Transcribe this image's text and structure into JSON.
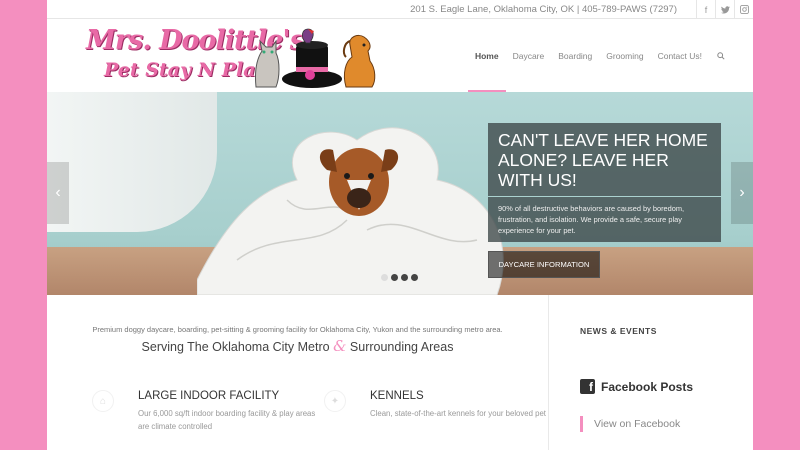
{
  "topbar": {
    "address": "201 S. Eagle Lane, Oklahoma City, OK | 405-789-PAWS (7297)",
    "social": [
      {
        "icon": "facebook-icon",
        "glyph": "f"
      },
      {
        "icon": "twitter-icon",
        "glyph": "🐦"
      },
      {
        "icon": "instagram-icon",
        "glyph": "◎"
      }
    ]
  },
  "logo": {
    "line1": "Mrs. Doolittle's",
    "line2": "Pet Stay N Play"
  },
  "nav": {
    "items": [
      "Home",
      "Daycare",
      "Boarding",
      "Grooming",
      "Contact Us!"
    ],
    "search_icon": "search-icon",
    "accent": "#f48fbf"
  },
  "hero": {
    "heading": "CAN'T LEAVE HER HOME ALONE? LEAVE HER WITH US!",
    "body": "90% of all destructive behaviors are caused by boredom, frustration, and isolation. We provide a safe, secure play experience for your pet.",
    "cta": "DAYCARE INFORMATION",
    "prev_icon": "chevron-left-icon",
    "next_icon": "chevron-right-icon"
  },
  "main": {
    "intro": "Premium doggy daycare, boarding, pet-sitting & grooming facility for Oklahoma City, Yukon and the surrounding metro area.",
    "tagline_a": "Serving The Oklahoma City Metro",
    "tagline_amp": "&",
    "tagline_b": "Surrounding Areas",
    "features": [
      {
        "title": "LARGE INDOOR FACILITY",
        "desc": "Our 6,000 sq/ft indoor boarding facility & play areas are climate controlled"
      },
      {
        "title": "KENNELS",
        "desc": "Clean, state-of-the-art kennels for your beloved pet"
      }
    ]
  },
  "sidebar": {
    "news_heading": "NEWS & EVENTS",
    "facebook_heading": "Facebook Posts",
    "facebook_link": "View on Facebook"
  },
  "colors": {
    "page_bg": "#f48fbf",
    "brand_pink": "#e86aa6"
  }
}
